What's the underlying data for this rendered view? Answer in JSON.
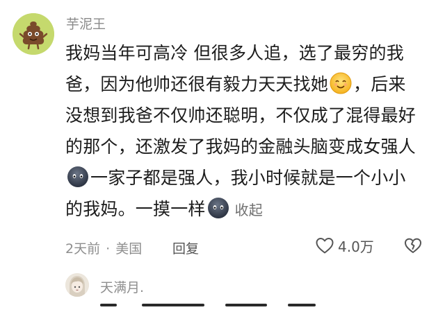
{
  "comment": {
    "username": "芋泥王",
    "lines": [
      {
        "text": "我妈当年可高冷 但很多人追，选了最穷的我"
      },
      {
        "before": "爸，因为他帅还很有毅力天天找她",
        "after": "，后来"
      },
      {
        "text": "没想到我爸不仅帅还聪明，不仅成了混得最好"
      },
      {
        "text": "的那个，还激发了我妈的金融头脑变成女强人"
      },
      {
        "after": "一家子都是强人，我小时候就是一个小小"
      },
      {
        "before": "的我妈。一摸一样"
      }
    ],
    "collapse_label": "收起",
    "time": "2天前",
    "separator": "·",
    "location": "美国",
    "reply_label": "回复",
    "like_count": "4.0万"
  },
  "reply": {
    "username": "天满月."
  },
  "colors": {
    "avatar_bg": "#c5d96d",
    "meta_text": "#8e8e8e"
  },
  "icons": {
    "avatar": "poop-character-icon",
    "smile_emoji": "smiling-face-emoji",
    "dark_emoji": "dark-face-emoji",
    "like": "heart-outline-icon",
    "dislike": "broken-heart-icon"
  }
}
